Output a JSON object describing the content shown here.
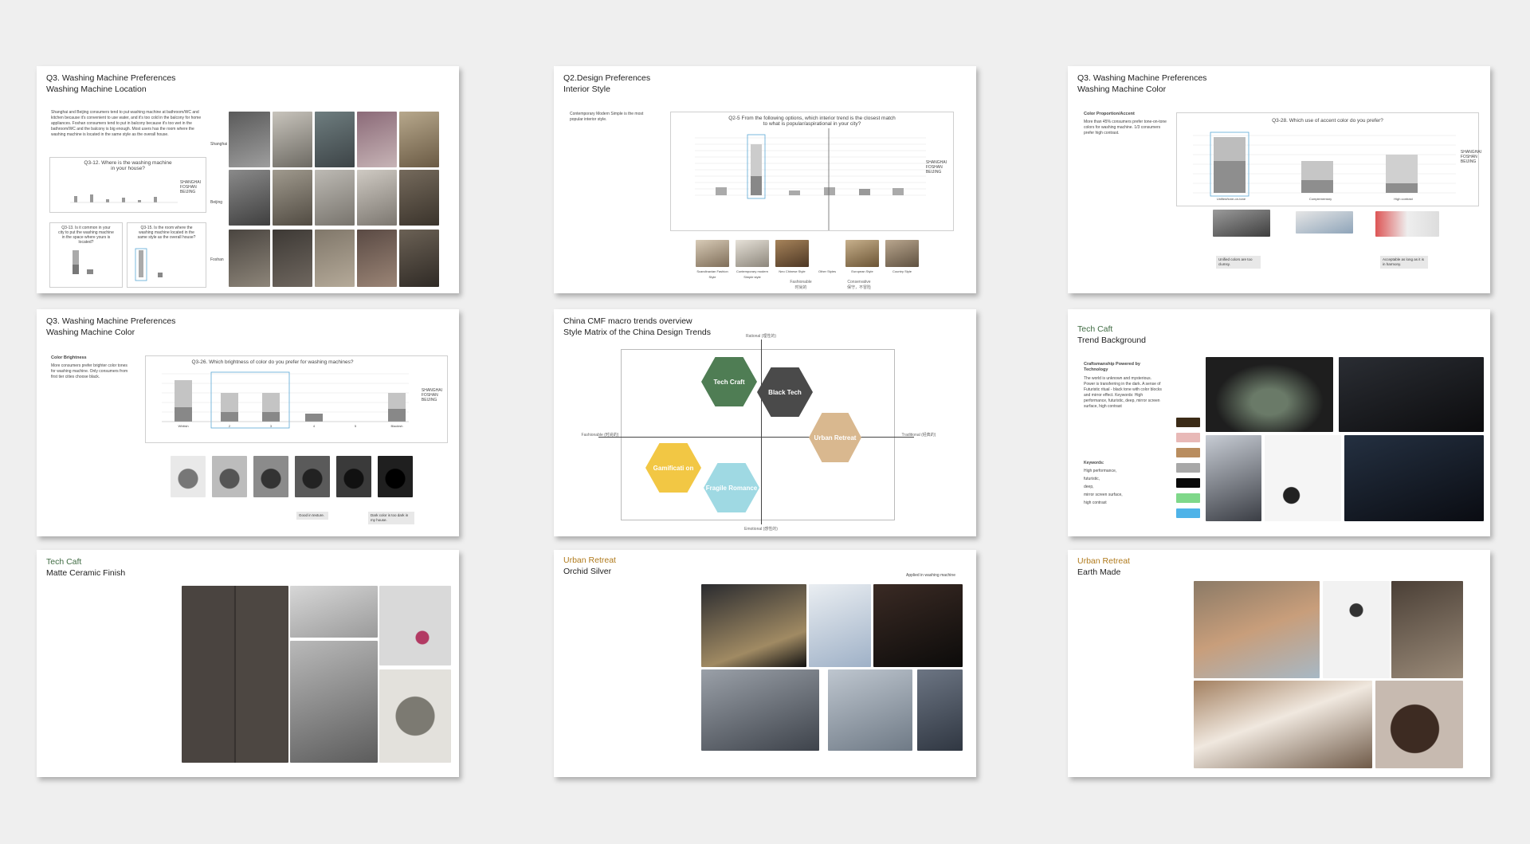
{
  "slides": [
    {
      "title": "Q3. Washing Machine Preferences",
      "subtitle": "Washing Machine Location",
      "body": "Shanghai and Beijing consumers tend to put washing machine at bathroom/WC and kitchen because it's convenient to use water, and it's too cold in the balcony for home appliances. Foshan consumers tend to put in balcony because it's too wet in the bathroom/WC and the balcony is big enough. Most users has the room where the washing machine is located in the same style as the overall house.",
      "chart1_title": "Q3-12. Where is the washing machine in your house?",
      "chart2_title": "Q3-13. Is it common in your city to put the washing machine in the space where yours is located?",
      "chart3_title": "Q3-15. Is the room where the washing machine located in the same style as the overall house?",
      "legend": [
        "SHANGHAI",
        "FOSHAN",
        "BEIJING"
      ],
      "rows": [
        "Shanghai",
        "Beijing",
        "Foshan"
      ]
    },
    {
      "title": "Q2.Design Preferences",
      "subtitle": "Interior Style",
      "body": "Contemporary Modern Simple is the most popular interior style.",
      "chart_title": "Q2-5 From the following options, which interior trend is the closest match to what is popular/aspirational in your city?",
      "legend": [
        "SHANGHAI",
        "FOSHAN",
        "BEIJING"
      ],
      "styles": [
        "Scandinavian Fashion Style",
        "Contemporary modern Simple style",
        "Neo Chinese Style",
        "Other Styles",
        "European Style",
        "Country Style"
      ],
      "axis_left": "Fashionable",
      "axis_right": "Conservative",
      "axis_left_cn": "时尚的",
      "axis_right_cn": "保守，不冒险"
    },
    {
      "title": "Q3. Washing Machine Preferences",
      "subtitle": "Washing Machine Color",
      "heading": "Color Proportion/Accent",
      "body": "More than 45% consumers prefer tone-on-tone colors for washing machine. 1/3 consumers prefer high contrast.",
      "chart_title": "Q3-28. Which use of accent color do you prefer?",
      "categories": [
        "Unified/tone-on-tone",
        "Complementary",
        "High contrast"
      ],
      "legend": [
        "SHANGHAI",
        "FOSHAN",
        "BEIJING"
      ],
      "tag1": "Unified colors are too clumsy.",
      "tag2": "Acceptable as long as it is in harmony."
    },
    {
      "title": "Q3. Washing Machine Preferences",
      "subtitle": "Washing Machine Color",
      "heading": "Color Brightness",
      "body": "More consumers prefer brighter color tones for washing machine. Only consumers from first tier cities choose black.",
      "chart_title": "Q3-26. Which brightness of color do you prefer for washing machines?",
      "categories": [
        "Whitish",
        "2",
        "3",
        "4",
        "5",
        "Blackish"
      ],
      "legend": [
        "SHANGHAI",
        "FOSHAN",
        "BEIJING"
      ],
      "tag1": "Good in texture.",
      "tag2": "Dark color is too dark in my house."
    },
    {
      "title": "China CMF macro trends overview",
      "subtitle": "Style Matrix of the China Design Trends",
      "axis_top": "Rational (理性的)",
      "axis_bottom": "Emotional (感性的)",
      "axis_left": "Fashionable (时尚的)",
      "axis_right": "Traditional (经典的)",
      "trends": [
        {
          "label": "Tech Craft",
          "color": "#4f7d54"
        },
        {
          "label": "Black Tech",
          "color": "#4a4a4a"
        },
        {
          "label": "Urban Retreat",
          "color": "#d9b88f"
        },
        {
          "label": "Gamificati on",
          "color": "#f2c744"
        },
        {
          "label": "Fragile Romance",
          "color": "#9fd9e3"
        }
      ]
    },
    {
      "title": "Tech Caft",
      "subtitle": "Trend Background",
      "heading": "Craftsmanship Powered by Technology",
      "body": "The world is unknown and mysterious. Power is transferring in the dark. A sense of Futuristic ritual - black tone with color blocks and mirror effect. Keywords: High performance, futuristic, deep, mirror screen surface, high contrast",
      "keywords_label": "Keywords:",
      "keywords": [
        "High performance,",
        "futuristic,",
        "deep,",
        "mirror screen surface,",
        "high contrast"
      ],
      "swatches": [
        "#3b2b17",
        "#e8b9b7",
        "#b98d5f",
        "#a8a8a8",
        "#0a0a0a",
        "#7fd88a",
        "#4fb3e8"
      ]
    },
    {
      "title": "Tech Caft",
      "subtitle": "Matte Ceramic Finish"
    },
    {
      "title": "Urban Retreat",
      "subtitle": "Orchid Silver",
      "note": "Applied in washing machine"
    },
    {
      "title": "Urban Retreat",
      "subtitle": "Earth Made"
    }
  ]
}
